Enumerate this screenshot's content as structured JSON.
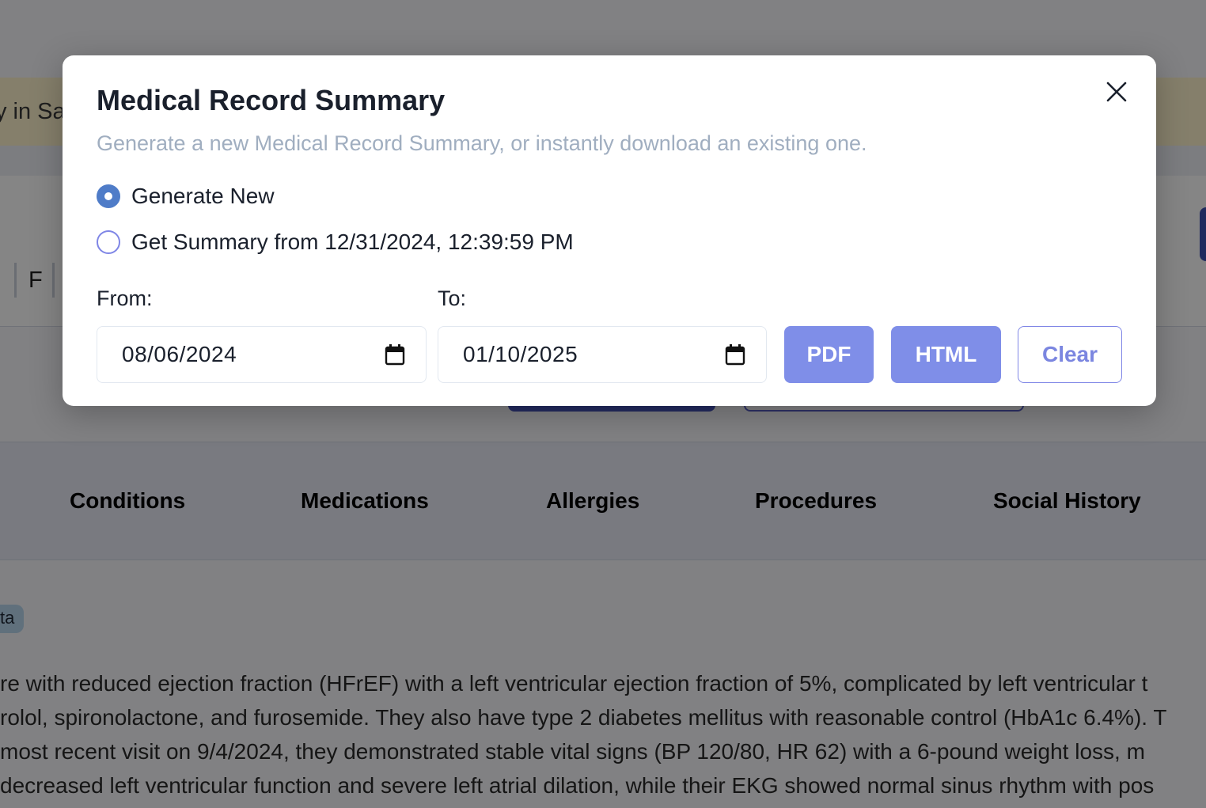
{
  "background": {
    "banner_text": "y in Sa",
    "patient_fields": {
      "edge_value": "l",
      "sex_value": "F"
    },
    "tabs": [
      "Conditions",
      "Medications",
      "Allergies",
      "Procedures",
      "Social History"
    ],
    "chip_label": "ta",
    "paragraph_lines": [
      "re with reduced ejection fraction (HFrEF) with a left ventricular ejection fraction of 5%, complicated by left ventricular t",
      "rolol, spironolactone, and furosemide. They also have type 2 diabetes mellitus with reasonable control (HbA1c 6.4%). T",
      " most recent visit on 9/4/2024, they demonstrated stable vital signs (BP 120/80, HR 62) with a 6-pound weight loss, m",
      " decreased left ventricular function and severe left atrial dilation, while their EKG showed normal sinus rhythm with pos"
    ]
  },
  "modal": {
    "title": "Medical Record Summary",
    "subtitle": "Generate a new Medical Record Summary, or instantly download an existing one.",
    "options": [
      {
        "label": "Generate New",
        "checked": true
      },
      {
        "label": "Get Summary from 12/31/2024, 12:39:59 PM",
        "checked": false
      }
    ],
    "from_label": "From:",
    "from_value": "08/06/2024",
    "to_label": "To:",
    "to_value": "01/10/2025",
    "pdf_label": "PDF",
    "html_label": "HTML",
    "clear_label": "Clear",
    "icons": {
      "close": "close-icon",
      "calendar": "calendar-icon"
    },
    "colors": {
      "primary": "#7f8ee8",
      "radio_checked": "#4f7cc8",
      "subtitle": "#a0aec0"
    }
  }
}
